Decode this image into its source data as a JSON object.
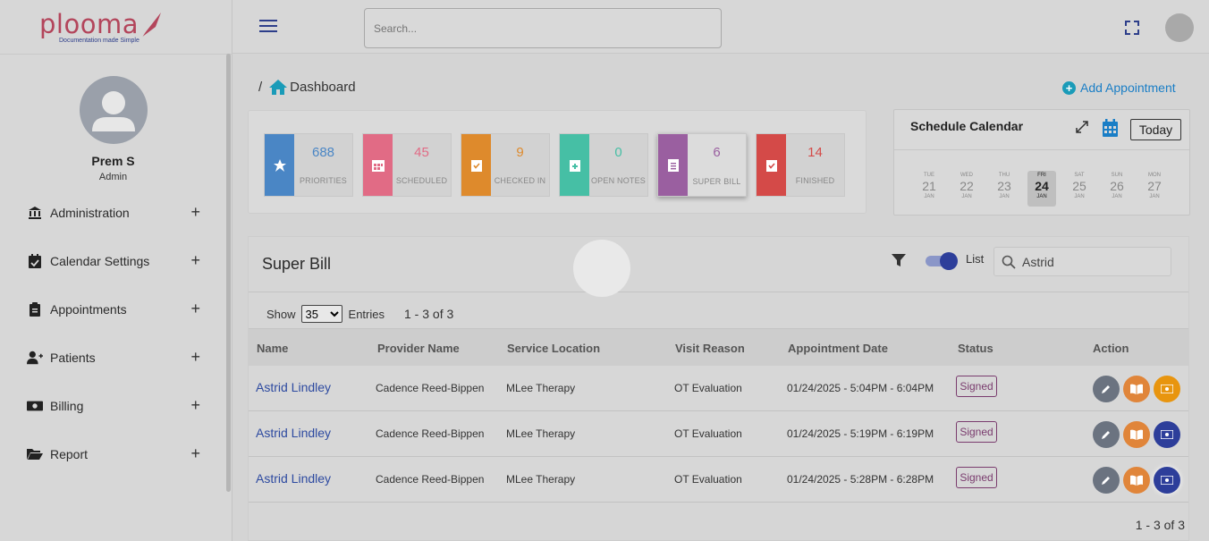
{
  "brand": {
    "name": "plooma",
    "tagline": "Documentation made Simple"
  },
  "user": {
    "name": "Prem S",
    "role": "Admin"
  },
  "sidebar": {
    "items": [
      {
        "label": "Administration",
        "icon": "bank-icon"
      },
      {
        "label": "Calendar Settings",
        "icon": "calendar-check-icon"
      },
      {
        "label": "Appointments",
        "icon": "clipboard-icon"
      },
      {
        "label": "Patients",
        "icon": "user-plus-icon"
      },
      {
        "label": "Billing",
        "icon": "money-icon"
      },
      {
        "label": "Report",
        "icon": "folder-open-icon"
      }
    ]
  },
  "topbar": {
    "search_placeholder": "Search..."
  },
  "breadcrumb": {
    "separator": "/",
    "current": "Dashboard"
  },
  "add_appointment_label": "Add Appointment",
  "stats": [
    {
      "value": "688",
      "label": "PRIORITIES",
      "color": "#4a86c5"
    },
    {
      "value": "45",
      "label": "SCHEDULED",
      "color": "#e16b85"
    },
    {
      "value": "9",
      "label": "CHECKED IN",
      "color": "#de8a2c"
    },
    {
      "value": "0",
      "label": "OPEN NOTES",
      "color": "#46bfa5"
    },
    {
      "value": "6",
      "label": "SUPER BILL",
      "color": "#9a5fa0"
    },
    {
      "value": "14",
      "label": "FINISHED",
      "color": "#d44a48"
    }
  ],
  "calendar": {
    "title": "Schedule Calendar",
    "today_label": "Today",
    "days": [
      {
        "dow": "TUE",
        "day": "21",
        "month": "JAN"
      },
      {
        "dow": "WED",
        "day": "22",
        "month": "JAN"
      },
      {
        "dow": "THU",
        "day": "23",
        "month": "JAN"
      },
      {
        "dow": "FRI",
        "day": "24",
        "month": "JAN",
        "selected": true
      },
      {
        "dow": "SAT",
        "day": "25",
        "month": "JAN"
      },
      {
        "dow": "SUN",
        "day": "26",
        "month": "JAN"
      },
      {
        "dow": "MON",
        "day": "27",
        "month": "JAN"
      }
    ]
  },
  "superbill": {
    "title": "Super Bill",
    "view_toggle_label": "List",
    "search_value": "Astrid",
    "show_label": "Show",
    "entries_select": "35",
    "entries_label": "Entries",
    "range": "1 - 3 of 3",
    "columns": [
      "Name",
      "Provider Name",
      "Service Location",
      "Visit Reason",
      "Appointment Date",
      "Status",
      "Action"
    ],
    "rows": [
      {
        "name": "Astrid Lindley",
        "provider": "Cadence Reed-Bippen",
        "location": "MLee Therapy",
        "reason": "OT Evaluation",
        "date": "01/24/2025 - 5:04PM - 6:04PM",
        "status": "Signed",
        "bill_color": "#e8950f"
      },
      {
        "name": "Astrid Lindley",
        "provider": "Cadence Reed-Bippen",
        "location": "MLee Therapy",
        "reason": "OT Evaluation",
        "date": "01/24/2025 - 5:19PM - 6:19PM",
        "status": "Signed",
        "bill_color": "#2d3e9a"
      },
      {
        "name": "Astrid Lindley",
        "provider": "Cadence Reed-Bippen",
        "location": "MLee Therapy",
        "reason": "OT Evaluation",
        "date": "01/24/2025 - 5:28PM - 6:28PM",
        "status": "Signed",
        "bill_color": "#2d3e9a"
      }
    ],
    "footer_range": "1 - 3 of 3"
  }
}
